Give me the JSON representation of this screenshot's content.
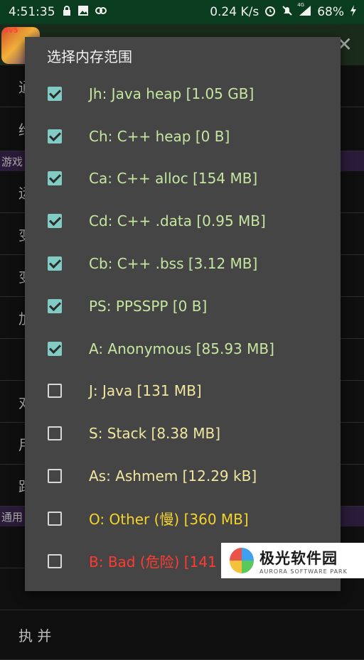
{
  "status_bar": {
    "time": "4:51:35",
    "net_speed": "0.24 K/s",
    "signal_label": "4G",
    "battery": "68%"
  },
  "background_app": {
    "rows": [
      "通",
      "给",
      "",
      "运",
      "变",
      "变",
      "加",
      "",
      "对",
      "用",
      "距",
      "",
      "",
      "执 并"
    ],
    "sections": [
      "游戏",
      "通用"
    ]
  },
  "dialog": {
    "title": "选择内存范围",
    "options": [
      {
        "label": "Jh: Java heap [1.05 GB]",
        "checked": true,
        "color": "#c5e6a0"
      },
      {
        "label": "Ch: C++ heap [0 B]",
        "checked": true,
        "color": "#c5e6a0"
      },
      {
        "label": "Ca: C++ alloc [154 MB]",
        "checked": true,
        "color": "#c5e6a0"
      },
      {
        "label": "Cd: C++ .data [0.95 MB]",
        "checked": true,
        "color": "#c5e6a0"
      },
      {
        "label": "Cb: C++ .bss [3.12 MB]",
        "checked": true,
        "color": "#c5e6a0"
      },
      {
        "label": "PS: PPSSPP [0 B]",
        "checked": true,
        "color": "#c5e6a0"
      },
      {
        "label": "A: Anonymous [85.93 MB]",
        "checked": true,
        "color": "#c5e6a0"
      },
      {
        "label": "J: Java [131 MB]",
        "checked": false,
        "color": "#f0e6a0"
      },
      {
        "label": "S: Stack [8.38 MB]",
        "checked": false,
        "color": "#f0e6a0"
      },
      {
        "label": "As: Ashmem [12.29 kB]",
        "checked": false,
        "color": "#f0e6a0"
      },
      {
        "label": "O: Other (慢) [360 MB]",
        "checked": false,
        "color": "#f5d32a"
      },
      {
        "label": "B: Bad (危险) [141 MB]",
        "checked": false,
        "color": "#ff3b30"
      }
    ]
  },
  "watermark": {
    "title": "极光软件园",
    "subtitle": "AURORA SOFTWARE PARK"
  },
  "colors": {
    "accent_check": "#80cbc4",
    "status_bar_bg": "#0a3d1f",
    "dialog_bg": "#454545"
  }
}
